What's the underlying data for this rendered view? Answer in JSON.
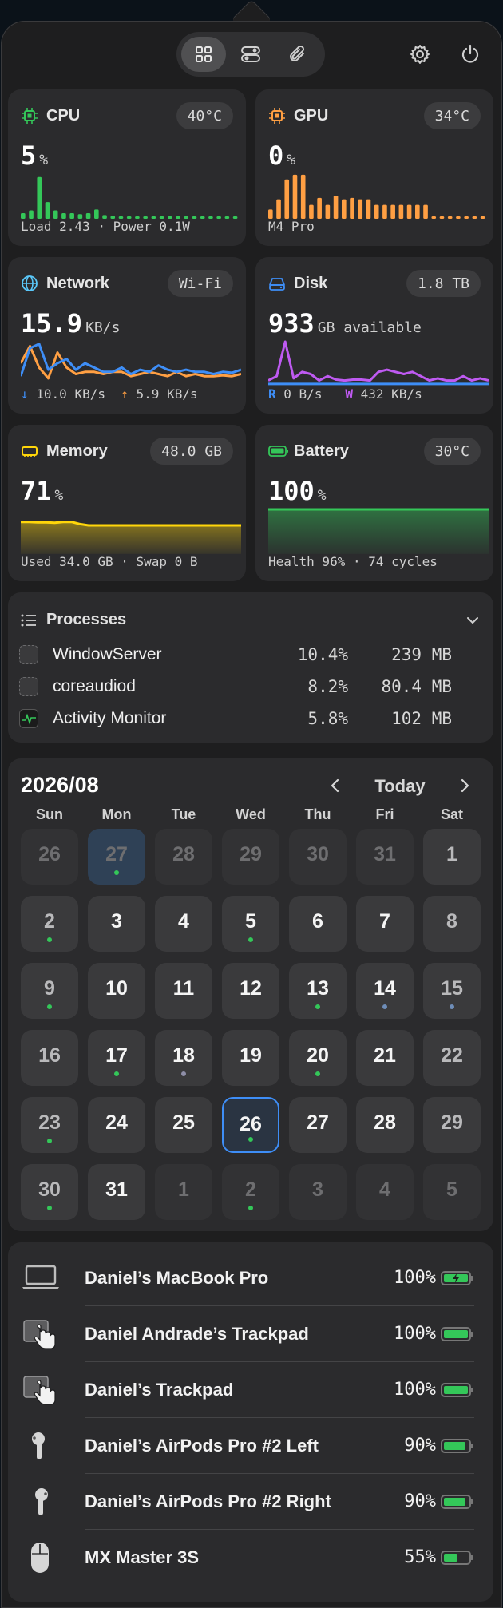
{
  "toolbar": {
    "tabs": [
      "dashboard-icon",
      "toggles-icon",
      "attachment-icon"
    ],
    "active_tab": 0
  },
  "cpu": {
    "title": "CPU",
    "badge": "40°C",
    "value": "5",
    "unit": "%",
    "footer": "Load 2.43 · Power 0.1W",
    "color": "#34c759",
    "bars": [
      0.12,
      0.18,
      0.9,
      0.36,
      0.18,
      0.12,
      0.12,
      0.1,
      0.12,
      0.2,
      0.08,
      0.06,
      0.05,
      0.05,
      0.05,
      0.05,
      0.05,
      0.05,
      0.05,
      0.05,
      0.05,
      0.05,
      0.05,
      0.05,
      0.05,
      0.05,
      0.05
    ]
  },
  "gpu": {
    "title": "GPU",
    "badge": "34°C",
    "value": "0",
    "unit": "%",
    "footer": "M4 Pro",
    "color": "#ff9f43",
    "bars": [
      0.2,
      0.42,
      0.85,
      0.95,
      0.95,
      0.3,
      0.45,
      0.3,
      0.5,
      0.42,
      0.45,
      0.42,
      0.42,
      0.3,
      0.3,
      0.3,
      0.3,
      0.3,
      0.3,
      0.3,
      0.05,
      0.05,
      0.05,
      0.05,
      0.05,
      0.05,
      0.05
    ]
  },
  "network": {
    "title": "Network",
    "badge": "Wi-Fi",
    "value": "15.9",
    "unit": "KB/s",
    "down": "10.0 KB/s",
    "up": "5.9 KB/s",
    "down_color": "#3e8ef7",
    "up_color": "#ff9f43",
    "down_series": [
      0.2,
      0.85,
      0.95,
      0.35,
      0.5,
      0.6,
      0.35,
      0.5,
      0.4,
      0.3,
      0.3,
      0.4,
      0.25,
      0.35,
      0.3,
      0.45,
      0.35,
      0.3,
      0.35,
      0.3,
      0.3,
      0.25,
      0.3,
      0.28,
      0.35
    ],
    "up_series": [
      0.5,
      0.9,
      0.4,
      0.15,
      0.75,
      0.4,
      0.25,
      0.3,
      0.3,
      0.25,
      0.3,
      0.3,
      0.2,
      0.25,
      0.3,
      0.25,
      0.2,
      0.3,
      0.2,
      0.25,
      0.2,
      0.2,
      0.22,
      0.2,
      0.25
    ]
  },
  "disk": {
    "title": "Disk",
    "badge": "1.8 TB",
    "value": "933",
    "unit": "GB available",
    "read_label": "R",
    "read": "0 B/s",
    "write_label": "W",
    "write": "432 KB/s",
    "read_color": "#3e8ef7",
    "write_color": "#bf5af2",
    "write_series": [
      0.1,
      0.2,
      1.0,
      0.15,
      0.3,
      0.25,
      0.1,
      0.2,
      0.12,
      0.1,
      0.12,
      0.12,
      0.1,
      0.3,
      0.35,
      0.3,
      0.25,
      0.3,
      0.2,
      0.1,
      0.15,
      0.1,
      0.1,
      0.2,
      0.1,
      0.15,
      0.1
    ],
    "read_series": [
      0.02,
      0.02,
      0.02,
      0.02,
      0.02,
      0.02,
      0.02,
      0.02,
      0.02,
      0.02,
      0.02,
      0.02,
      0.02,
      0.02,
      0.02,
      0.02,
      0.02,
      0.02,
      0.02,
      0.02,
      0.02,
      0.02,
      0.02,
      0.02,
      0.02,
      0.02,
      0.02
    ]
  },
  "memory": {
    "title": "Memory",
    "badge": "48.0 GB",
    "value": "71",
    "unit": "%",
    "footer": "Used 34.0 GB · Swap 0 B",
    "color": "#ffd60a",
    "series": [
      0.71,
      0.71,
      0.7,
      0.7,
      0.69,
      0.71,
      0.71,
      0.66,
      0.63,
      0.63,
      0.63,
      0.63,
      0.63,
      0.63,
      0.63,
      0.63,
      0.63,
      0.63,
      0.63,
      0.63,
      0.63,
      0.63,
      0.63,
      0.63,
      0.63,
      0.63,
      0.63
    ]
  },
  "battery": {
    "title": "Battery",
    "badge": "30°C",
    "value": "100",
    "unit": "%",
    "footer": "Health 96% · 74 cycles",
    "color": "#34c759",
    "series": [
      1,
      1,
      1,
      1,
      1,
      1,
      1,
      1,
      1,
      1,
      1,
      1,
      1,
      1,
      1,
      1,
      1,
      1,
      1,
      1
    ]
  },
  "processes": {
    "title": "Processes",
    "rows": [
      {
        "name": "WindowServer",
        "cpu": "10.4%",
        "mem": "239 MB"
      },
      {
        "name": "coreaudiod",
        "cpu": "8.2%",
        "mem": "80.4 MB"
      },
      {
        "name": "Activity Monitor",
        "cpu": "5.8%",
        "mem": "102 MB"
      }
    ]
  },
  "calendar": {
    "month_label": "2026/08",
    "today_label": "Today",
    "weekdays": [
      "Sun",
      "Mon",
      "Tue",
      "Wed",
      "Thu",
      "Fri",
      "Sat"
    ],
    "days": [
      {
        "n": "26",
        "muted": true
      },
      {
        "n": "27",
        "muted": true,
        "selected": true,
        "dot": "#34c759"
      },
      {
        "n": "28",
        "muted": true
      },
      {
        "n": "29",
        "muted": true
      },
      {
        "n": "30",
        "muted": true
      },
      {
        "n": "31",
        "muted": true
      },
      {
        "n": "1"
      },
      {
        "n": "2",
        "dot": "#34c759"
      },
      {
        "n": "3"
      },
      {
        "n": "4"
      },
      {
        "n": "5",
        "dot": "#34c759"
      },
      {
        "n": "6"
      },
      {
        "n": "7"
      },
      {
        "n": "8"
      },
      {
        "n": "9",
        "dot": "#34c759"
      },
      {
        "n": "10"
      },
      {
        "n": "11"
      },
      {
        "n": "12"
      },
      {
        "n": "13",
        "dot": "#34c759"
      },
      {
        "n": "14",
        "dot": "#6e8db8"
      },
      {
        "n": "15",
        "dot": "#6e8db8"
      },
      {
        "n": "16"
      },
      {
        "n": "17",
        "dot": "#34c759"
      },
      {
        "n": "18",
        "dot": "#8e8ea8"
      },
      {
        "n": "19"
      },
      {
        "n": "20",
        "dot": "#34c759"
      },
      {
        "n": "21"
      },
      {
        "n": "22"
      },
      {
        "n": "23",
        "dot": "#34c759"
      },
      {
        "n": "24"
      },
      {
        "n": "25"
      },
      {
        "n": "26",
        "today": true,
        "dot": "#34c759"
      },
      {
        "n": "27"
      },
      {
        "n": "28"
      },
      {
        "n": "29"
      },
      {
        "n": "30",
        "dot": "#34c759"
      },
      {
        "n": "31"
      },
      {
        "n": "1",
        "muted": true
      },
      {
        "n": "2",
        "muted": true,
        "dot": "#34c759"
      },
      {
        "n": "3",
        "muted": true
      },
      {
        "n": "4",
        "muted": true
      },
      {
        "n": "5",
        "muted": true
      }
    ]
  },
  "devices": [
    {
      "name": "Daniel’s MacBook Pro",
      "pct": "100%",
      "level": 1.0,
      "charging": true,
      "icon": "laptop-icon"
    },
    {
      "name": "Daniel Andrade’s Trackpad",
      "pct": "100%",
      "level": 1.0,
      "icon": "trackpad-icon"
    },
    {
      "name": "Daniel’s Trackpad",
      "pct": "100%",
      "level": 1.0,
      "icon": "trackpad-icon"
    },
    {
      "name": "Daniel’s AirPods Pro #2 Left",
      "pct": "90%",
      "level": 0.9,
      "icon": "airpod-left-icon"
    },
    {
      "name": "Daniel’s AirPods Pro #2 Right",
      "pct": "90%",
      "level": 0.9,
      "icon": "airpod-right-icon"
    },
    {
      "name": "MX Master 3S",
      "pct": "55%",
      "level": 0.55,
      "icon": "mouse-icon"
    }
  ]
}
